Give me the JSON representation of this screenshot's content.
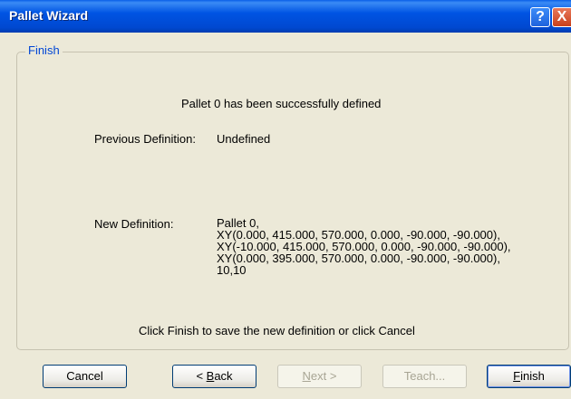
{
  "window": {
    "title": "Pallet Wizard",
    "help_glyph": "?",
    "close_glyph": "X"
  },
  "group": {
    "label": "Finish"
  },
  "content": {
    "success_message": "Pallet 0 has been successfully defined",
    "previous_label": "Previous Definition:",
    "previous_value": "Undefined",
    "new_label": "New Definition:",
    "new_lines": [
      "Pallet 0,",
      "XY(0.000, 415.000, 570.000, 0.000, -90.000, -90.000),",
      "XY(-10.000, 415.000, 570.000, 0.000, -90.000, -90.000),",
      "XY(0.000, 395.000, 570.000, 0.000, -90.000, -90.000),",
      "10,10"
    ],
    "hint": "Click Finish to save the new definition or click Cancel"
  },
  "buttons": {
    "cancel": "Cancel",
    "back_prefix": "< ",
    "back_mnemonic": "B",
    "back_rest": "ack",
    "next_mnemonic": "N",
    "next_rest": "ext >",
    "teach": "Teach...",
    "finish_mnemonic": "F",
    "finish_rest": "inish"
  }
}
